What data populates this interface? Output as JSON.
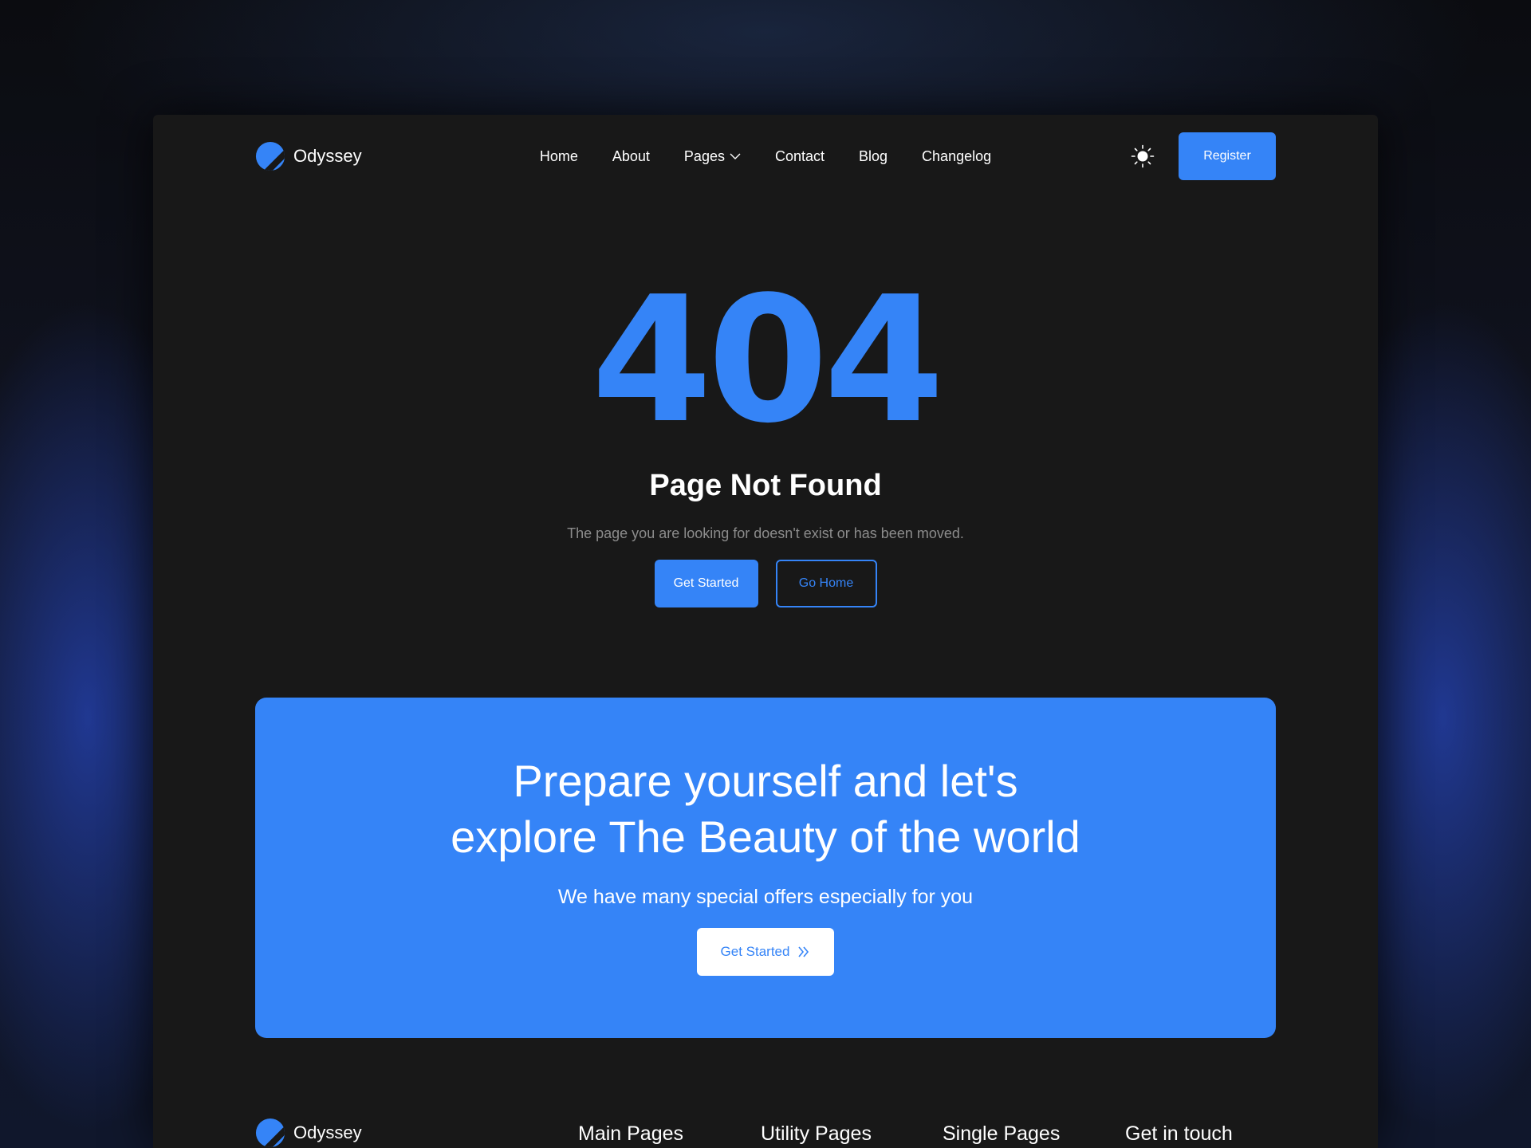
{
  "brand": {
    "name": "Odyssey",
    "accent": "#3584f7"
  },
  "nav": {
    "items": [
      {
        "label": "Home"
      },
      {
        "label": "About"
      },
      {
        "label": "Pages",
        "has_dropdown": true
      },
      {
        "label": "Contact"
      },
      {
        "label": "Blog"
      },
      {
        "label": "Changelog"
      }
    ],
    "theme_icon": "sun-icon",
    "register_label": "Register"
  },
  "hero": {
    "code": "404",
    "title": "Page Not Found",
    "subtitle": "The page you are looking for doesn't exist or has been moved.",
    "primary_label": "Get Started",
    "secondary_label": "Go Home"
  },
  "cta": {
    "heading_line1": "Prepare yourself and let's",
    "heading_line2": "explore The Beauty of the world",
    "subtitle": "We have many special offers especially for you",
    "button_label": "Get Started",
    "button_icon": "double-chevron-right-icon"
  },
  "footer": {
    "brand_name": "Odyssey",
    "columns": [
      "Main Pages",
      "Utility Pages",
      "Single Pages",
      "Get in touch"
    ]
  }
}
